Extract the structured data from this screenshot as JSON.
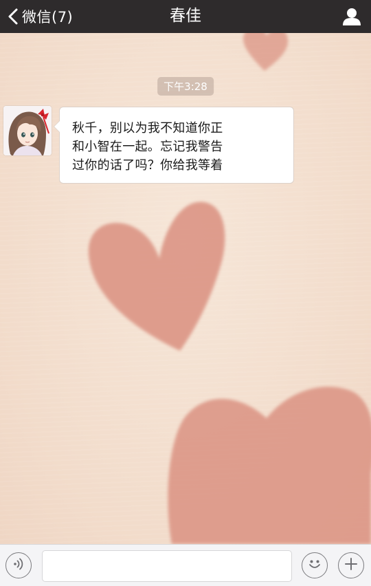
{
  "nav": {
    "back_label": "微信(7)",
    "title": "春佳",
    "back_icon": "chevron-left-icon",
    "profile_icon": "person-icon"
  },
  "chat": {
    "timestamp": "下午3:28",
    "messages": [
      {
        "sender": "春佳",
        "lines": [
          "秋千，别以为我不知道你正",
          "和小智在一起。忘记我警告",
          "过你的话了吗？你给我等着"
        ]
      }
    ]
  },
  "input_bar": {
    "voice_icon": "voice-icon",
    "emoji_icon": "emoji-icon",
    "plus_icon": "plus-icon",
    "text_value": "",
    "placeholder": ""
  },
  "colors": {
    "nav_bg": "#2e2b2c",
    "chat_bg": "#f3dfcf",
    "heart": "#dc9585",
    "bubble_bg": "#ffffff",
    "input_bar_bg": "#f4f4f6"
  }
}
